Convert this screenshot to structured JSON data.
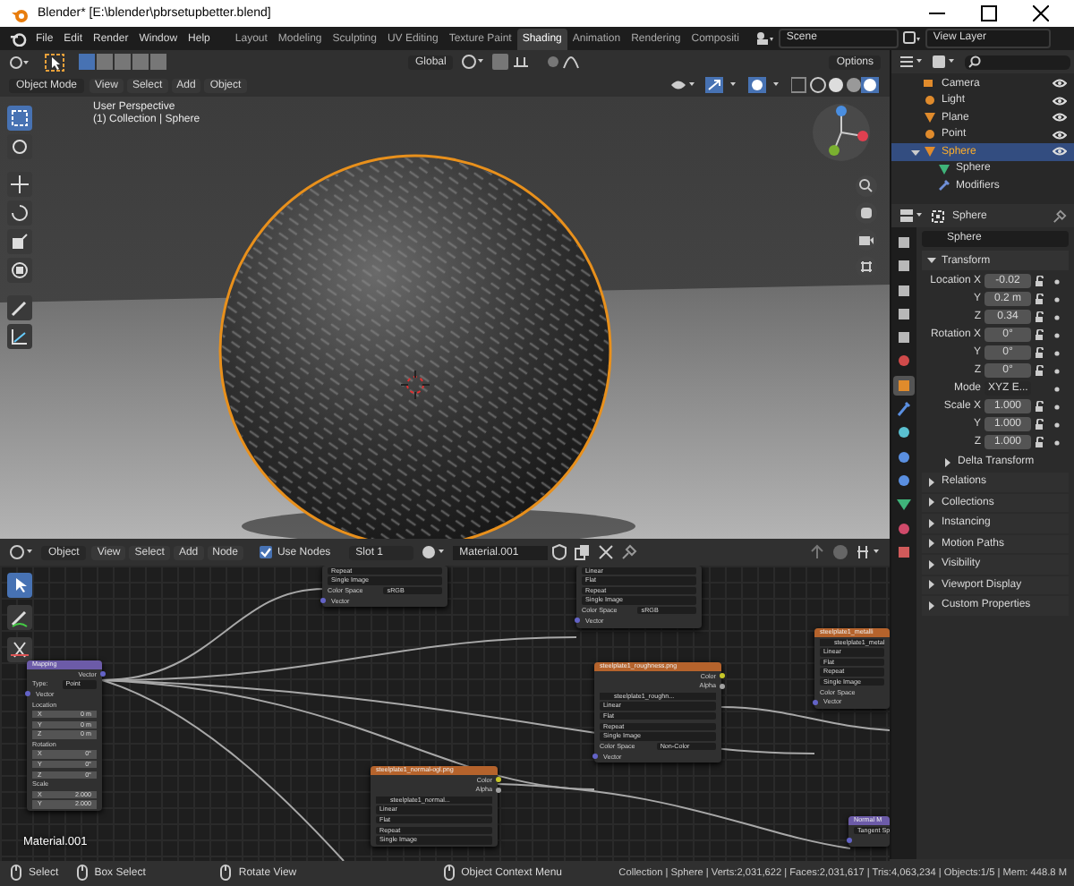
{
  "window": {
    "title": "Blender* [E:\\blender\\pbrsetupbetter.blend]"
  },
  "menu": [
    "File",
    "Edit",
    "Render",
    "Window",
    "Help"
  ],
  "workspaces": [
    {
      "label": "Layout",
      "selected": false
    },
    {
      "label": "Modeling",
      "selected": false
    },
    {
      "label": "Sculpting",
      "selected": false
    },
    {
      "label": "UV Editing",
      "selected": false
    },
    {
      "label": "Texture Paint",
      "selected": false
    },
    {
      "label": "Shading",
      "selected": true
    },
    {
      "label": "Animation",
      "selected": false
    },
    {
      "label": "Rendering",
      "selected": false
    },
    {
      "label": "Compositi",
      "selected": false
    }
  ],
  "scene": "Scene",
  "view_layer": "View Layer",
  "viewport": {
    "orientation": "Global",
    "options": "Options",
    "mode": "Object Mode",
    "menu": [
      "View",
      "Select",
      "Add",
      "Object"
    ],
    "info": [
      "User Perspective",
      "(1) Collection | Sphere"
    ]
  },
  "node_editor": {
    "object_type": "Object",
    "menu": [
      "View",
      "Select",
      "Add",
      "Node"
    ],
    "use_nodes": {
      "label": "Use Nodes",
      "checked": true
    },
    "slot": "Slot 1",
    "material": "Material.001",
    "material_label": "Material.001",
    "nodes": [
      {
        "rows": [
          {
            "kind": "dropdown",
            "text": "Repeat"
          },
          {
            "kind": "dropdown",
            "text": "Single Image"
          },
          {
            "kind": "prop",
            "text": "Color Space",
            "value": "sRGB"
          },
          {
            "kind": "input",
            "text": "Vector",
            "color": "#6363c7"
          }
        ]
      },
      {
        "rows": [
          {
            "kind": "dropdown",
            "text": "Linear"
          },
          {
            "kind": "dropdown",
            "text": "Flat"
          },
          {
            "kind": "dropdown",
            "text": "Repeat"
          },
          {
            "kind": "dropdown",
            "text": "Single Image"
          },
          {
            "kind": "prop",
            "text": "Color Space",
            "value": "sRGB"
          },
          {
            "kind": "input",
            "text": "Vector",
            "color": "#6363c7"
          }
        ]
      },
      {
        "title": "Mapping",
        "color": "#6c5ba8",
        "rows": [
          {
            "kind": "output",
            "text": "Vector",
            "color": "#6363c7"
          },
          {
            "kind": "prop",
            "text": "Type:",
            "value": "Point"
          },
          {
            "kind": "input",
            "text": "Vector",
            "color": "#6363c7"
          },
          {
            "kind": "heading",
            "text": "Location"
          },
          {
            "kind": "field",
            "text": "X",
            "value": "0 m"
          },
          {
            "kind": "field",
            "text": "Y",
            "value": "0 m"
          },
          {
            "kind": "field",
            "text": "Z",
            "value": "0 m"
          },
          {
            "kind": "heading",
            "text": "Rotation"
          },
          {
            "kind": "field",
            "text": "X",
            "value": "0°"
          },
          {
            "kind": "field",
            "text": "Y",
            "value": "0°"
          },
          {
            "kind": "field",
            "text": "Z",
            "value": "0°"
          },
          {
            "kind": "heading",
            "text": "Scale"
          },
          {
            "kind": "field",
            "text": "X",
            "value": "2.000"
          },
          {
            "kind": "field",
            "text": "Y",
            "value": "2.000"
          }
        ]
      },
      {
        "title": "steelplate1_roughness.png",
        "color": "#b5632c",
        "rows": [
          {
            "kind": "output",
            "text": "Color",
            "color": "#c7c729"
          },
          {
            "kind": "output",
            "text": "Alpha",
            "color": "#a1a1a1"
          },
          {
            "kind": "file",
            "text": "steelplate1_roughn..."
          },
          {
            "kind": "dropdown",
            "text": "Linear"
          },
          {
            "kind": "dropdown",
            "text": "Flat"
          },
          {
            "kind": "dropdown",
            "text": "Repeat"
          },
          {
            "kind": "dropdown",
            "text": "Single Image"
          },
          {
            "kind": "prop",
            "text": "Color Space",
            "value": "Non-Color"
          },
          {
            "kind": "input",
            "text": "Vector",
            "color": "#6363c7"
          }
        ]
      },
      {
        "title": "steelplate1_metalli",
        "color": "#b5632c",
        "rows": [
          {
            "kind": "file",
            "text": "steelplate1_metal"
          },
          {
            "kind": "dropdown",
            "text": "Linear"
          },
          {
            "kind": "dropdown",
            "text": "Flat"
          },
          {
            "kind": "dropdown",
            "text": "Repeat"
          },
          {
            "kind": "dropdown",
            "text": "Single Image"
          },
          {
            "kind": "heading",
            "text": "Color Space"
          },
          {
            "kind": "input",
            "text": "Vector",
            "color": "#6363c7"
          }
        ]
      },
      {
        "title": "steelplate1_normal-ogl.png",
        "color": "#b5632c",
        "rows": [
          {
            "kind": "output",
            "text": "Color",
            "color": "#c7c729"
          },
          {
            "kind": "output",
            "text": "Alpha",
            "color": "#a1a1a1"
          },
          {
            "kind": "file",
            "text": "steelplate1_normal..."
          },
          {
            "kind": "dropdown",
            "text": "Linear"
          },
          {
            "kind": "dropdown",
            "text": "Flat"
          },
          {
            "kind": "dropdown",
            "text": "Repeat"
          },
          {
            "kind": "dropdown",
            "text": "Single Image"
          }
        ]
      },
      {
        "title": "Normal M",
        "color": "#6c5ba8",
        "rows": [
          {
            "kind": "dropdown",
            "text": "Tangent Sp"
          },
          {
            "kind": "input",
            "color": "#6363c7"
          }
        ]
      }
    ]
  },
  "outliner": {
    "items": [
      {
        "name": "Camera",
        "kind": "camera",
        "selected": false
      },
      {
        "name": "Light",
        "kind": "light",
        "selected": false
      },
      {
        "name": "Plane",
        "kind": "mesh",
        "selected": false
      },
      {
        "name": "Point",
        "kind": "light",
        "selected": false
      },
      {
        "name": "Sphere",
        "kind": "mesh",
        "selected": true,
        "expanded": true,
        "children": [
          {
            "name": "Sphere",
            "kind": "mesh_data",
            "selected": false
          },
          {
            "name": "Modifiers",
            "kind": "modifiers",
            "selected": false
          }
        ]
      }
    ]
  },
  "properties": {
    "object_name": "Sphere",
    "datablock": "Sphere",
    "tabs": [
      {
        "kind": "tool",
        "selected": false
      },
      {
        "kind": "render",
        "selected": false
      },
      {
        "kind": "output",
        "selected": false
      },
      {
        "kind": "view_layer",
        "selected": false
      },
      {
        "kind": "scene",
        "selected": false
      },
      {
        "kind": "world",
        "selected": false
      },
      {
        "kind": "object",
        "selected": true
      },
      {
        "kind": "modifiers",
        "selected": false
      },
      {
        "kind": "particles",
        "selected": false
      },
      {
        "kind": "physics",
        "selected": false
      },
      {
        "kind": "constraints",
        "selected": false
      },
      {
        "kind": "data",
        "selected": false
      },
      {
        "kind": "material",
        "selected": false
      },
      {
        "kind": "texture",
        "selected": false
      }
    ],
    "transform": {
      "title": "Transform",
      "expanded": true,
      "rows": [
        {
          "kind": "number",
          "label": "Location X",
          "value": "-0.02"
        },
        {
          "kind": "number",
          "label": "Y",
          "value": "0.2 m"
        },
        {
          "kind": "number",
          "label": "Z",
          "value": "0.34"
        },
        {
          "kind": "number",
          "label": "Rotation X",
          "value": "0°"
        },
        {
          "kind": "number",
          "label": "Y",
          "value": "0°"
        },
        {
          "kind": "number",
          "label": "Z",
          "value": "0°"
        },
        {
          "kind": "dropdown",
          "label": "Mode",
          "value": "XYZ E..."
        },
        {
          "kind": "number",
          "label": "Scale X",
          "value": "1.000"
        },
        {
          "kind": "number",
          "label": "Y",
          "value": "1.000"
        },
        {
          "kind": "number",
          "label": "Z",
          "value": "1.000"
        }
      ],
      "subpanel": {
        "title": "Delta Transform",
        "expanded": false
      }
    },
    "panels": [
      {
        "title": "Relations",
        "expanded": false
      },
      {
        "title": "Collections",
        "expanded": false
      },
      {
        "title": "Instancing",
        "expanded": false
      },
      {
        "title": "Motion Paths",
        "expanded": false
      },
      {
        "title": "Visibility",
        "expanded": false
      },
      {
        "title": "Viewport Display",
        "expanded": false
      },
      {
        "title": "Custom Properties",
        "expanded": false
      }
    ]
  },
  "status_bar": {
    "hints": [
      "Select",
      "Box Select",
      "Rotate View",
      "Object Context Menu"
    ],
    "stats": "Collection | Sphere | Verts:2,031,622 | Faces:2,031,617 | Tris:4,063,234 | Objects:1/5 | Mem: 448.8 M"
  }
}
